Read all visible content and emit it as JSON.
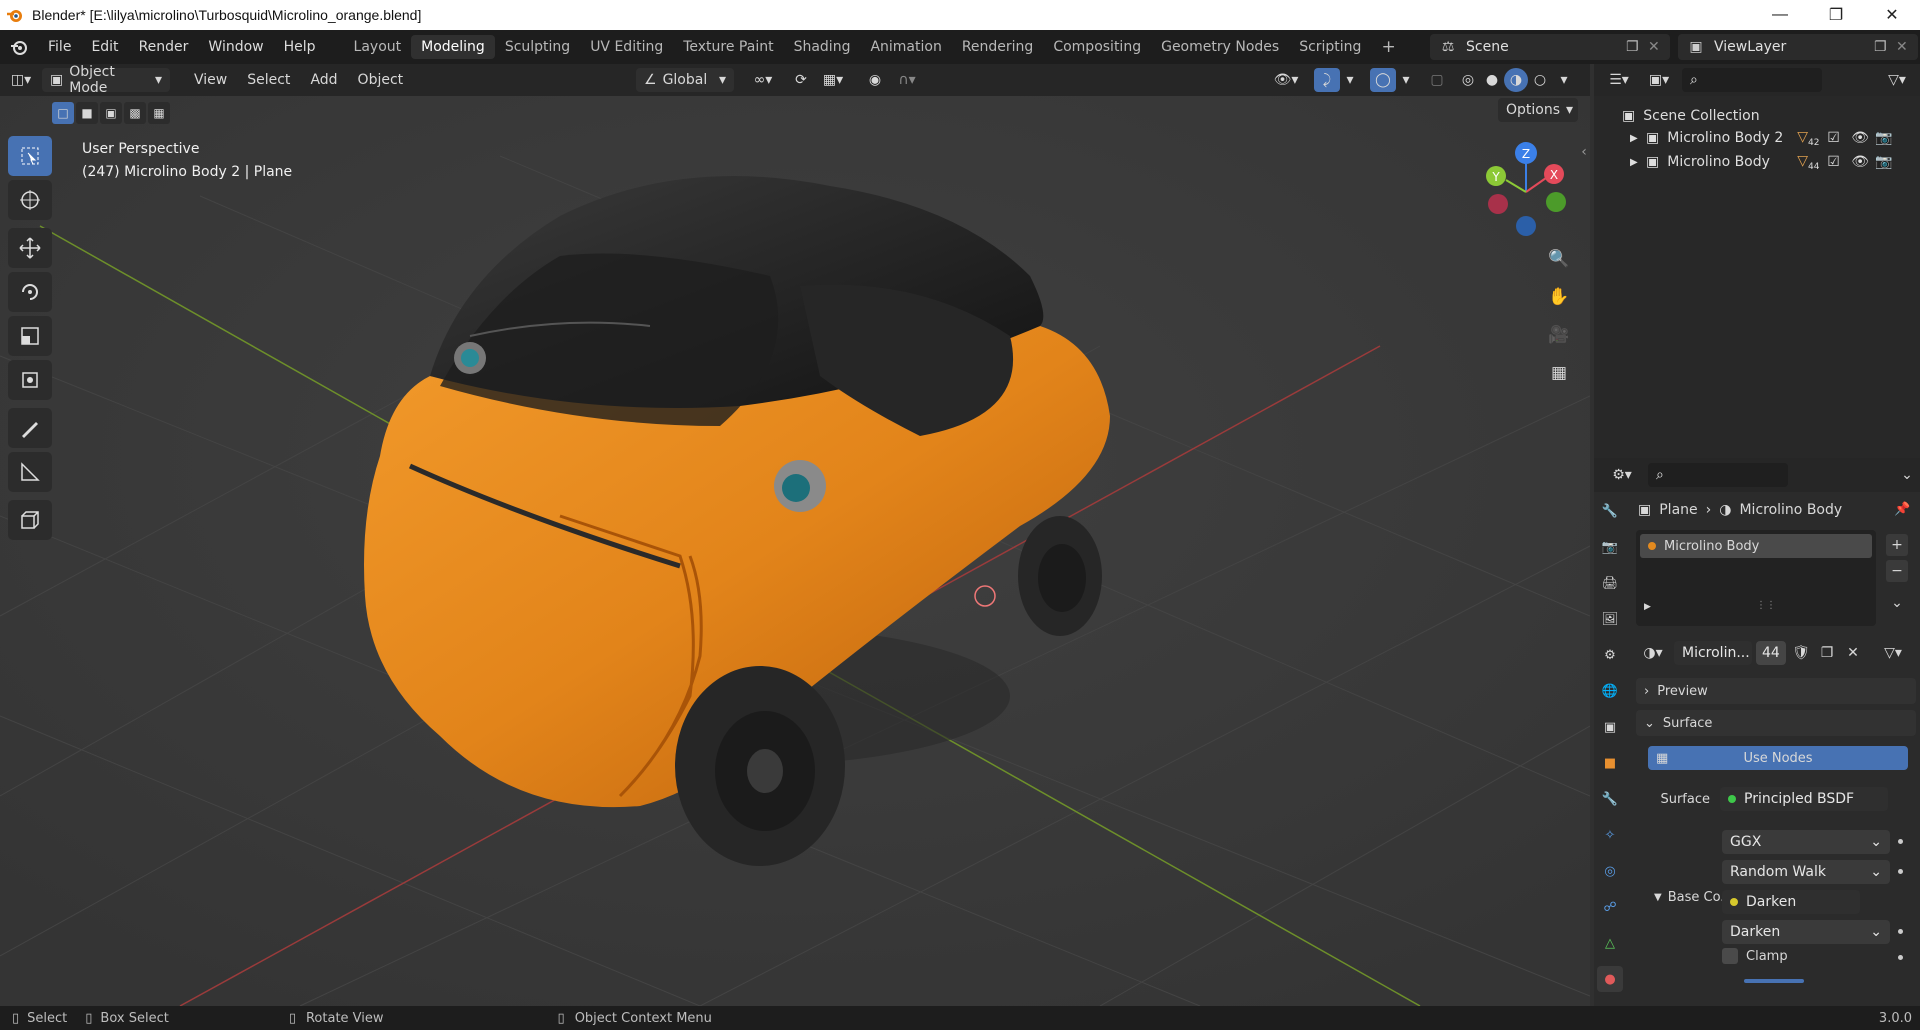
{
  "window": {
    "title": "Blender* [E:\\lilya\\microlino\\Turbosquid\\Microlino_orange.blend]"
  },
  "menu": [
    "File",
    "Edit",
    "Render",
    "Window",
    "Help"
  ],
  "workspaces": [
    "Layout",
    "Modeling",
    "Sculpting",
    "UV Editing",
    "Texture Paint",
    "Shading",
    "Animation",
    "Rendering",
    "Compositing",
    "Geometry Nodes",
    "Scripting"
  ],
  "workspace_add": "+",
  "scene": {
    "name": "Scene",
    "view_layer": "ViewLayer"
  },
  "header": {
    "mode": "Object Mode",
    "menus": [
      "View",
      "Select",
      "Add",
      "Object"
    ],
    "orientation": "Global",
    "options": "Options"
  },
  "viewport": {
    "perspective": "User Perspective",
    "object_info": "(247) Microlino Body 2 | Plane",
    "gizmo": {
      "z": "Z",
      "x": "X",
      "y": "Y"
    }
  },
  "outliner": {
    "collection": "Scene Collection",
    "items": [
      {
        "label": "Microlino Body 2",
        "badge": "42"
      },
      {
        "label": "Microlino Body",
        "badge": "44"
      }
    ]
  },
  "properties": {
    "breadcrumb_object": "Plane",
    "breadcrumb_material": "Microlino Body",
    "slot": "Microlino Body",
    "material_name": "Microlin...",
    "user_count": "44",
    "panels": {
      "preview": "Preview",
      "surface": "Surface"
    },
    "use_nodes": "Use Nodes",
    "surface_label": "Surface",
    "surface_value": "Principled BSDF",
    "distribution": "GGX",
    "subsurface": "Random Walk",
    "base_color_label": "Base Co...",
    "base_color_value": "Darken",
    "blend_mode": "Darken",
    "clamp": "Clamp"
  },
  "status": {
    "select": "Select",
    "box_select": "Box Select",
    "rotate": "Rotate View",
    "context": "Object Context Menu",
    "version": "3.0.0"
  },
  "colors": {
    "accent": "#4772b3",
    "car": "#e38a1f",
    "active_tool": "#4772b3"
  }
}
